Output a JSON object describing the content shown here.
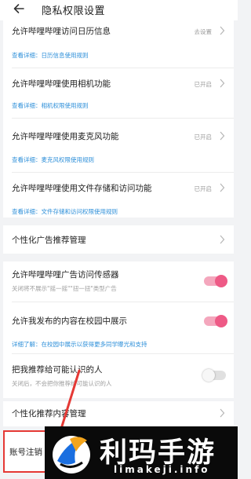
{
  "header": {
    "title": "隐私权限设置"
  },
  "rows": {
    "calendar": {
      "title": "允许哔哩哔哩访问日历信息",
      "status": "去设置",
      "link": "查看详细：日历信息使用规则"
    },
    "camera": {
      "title": "允许哔哩哔哩使用相机功能",
      "status": "已开启",
      "link": "查看详细：相机权限使用规则"
    },
    "microphone": {
      "title": "允许哔哩哔哩使用麦克风功能",
      "status": "已开启",
      "link": "查看详细：麦克风权限使用规则"
    },
    "storage": {
      "title": "允许哔哩哔哩使用文件存储和访问功能",
      "status": "已开启",
      "link": "查看详细：文件存储和访问权限使用规则"
    },
    "ad": {
      "title": "个性化广告推荐管理"
    },
    "sensor": {
      "title": "允许哔哩哔哩广告访问传感器",
      "desc": "关闭将不展示\"摇一摇\"\"扭一扭\"类型广告",
      "toggle_on": true
    },
    "campus": {
      "title": "允许我发布的内容在校园中展示",
      "link": "详细了解：在校园中展示以获得更多同学曝光和支持",
      "toggle_on": true
    },
    "recommend": {
      "title": "把我推荐给可能认识的人",
      "desc": "关闭后，不会把你推荐给可能认识的人",
      "toggle_on": false
    },
    "content": {
      "title": "个性化推荐内容管理"
    },
    "account": {
      "title": "账号注销"
    }
  },
  "watermark": {
    "title": "利玛手游",
    "url": "limakeji.info"
  },
  "colors": {
    "accent_pink": "#ee5a86",
    "link_blue": "#2d8fd9",
    "background": "#f2f3f5"
  }
}
